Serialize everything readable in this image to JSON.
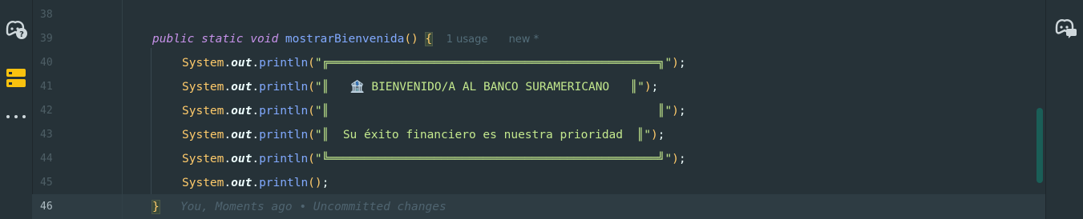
{
  "gutter": {
    "line_numbers": [
      "38",
      "39",
      "40",
      "41",
      "42",
      "43",
      "44",
      "45",
      "46"
    ],
    "active_line": "46"
  },
  "code": {
    "method_line": {
      "kw_public": "public",
      "kw_static": "static",
      "kw_void": "void",
      "method_name": "mostrarBienvenida",
      "parens": "()",
      "open_brace": "{",
      "usage_hint": "1 usage",
      "new_hint": "new *"
    },
    "print_class": "System",
    "print_field": "out",
    "print_method": "println",
    "lines": [
      {
        "arg": "\"╔═══════════════════════════════════════════════╗\""
      },
      {
        "arg": "\"║   🏦 BIENVENIDO/A AL BANCO SURAMERICANO   ║\""
      },
      {
        "arg": "\"║                                               ║\""
      },
      {
        "arg": "\"║  Su éxito financiero es nuestra prioridad  ║\""
      },
      {
        "arg": "\"╚═══════════════════════════════════════════════╝\""
      },
      {
        "arg": ""
      }
    ],
    "close_brace": "}",
    "blame": "You, Moments ago • Uncommitted changes"
  },
  "icons": {
    "left": [
      "copilot-help-icon",
      "database-icon",
      "more-icon"
    ],
    "right": [
      "copilot-chat-icon"
    ]
  },
  "colors": {
    "background": "#263238",
    "string": "#c3e88d",
    "keyword": "#c792ea",
    "method": "#82aaff",
    "class": "#ffcb6b",
    "scrollbar": "#1a5e57"
  }
}
